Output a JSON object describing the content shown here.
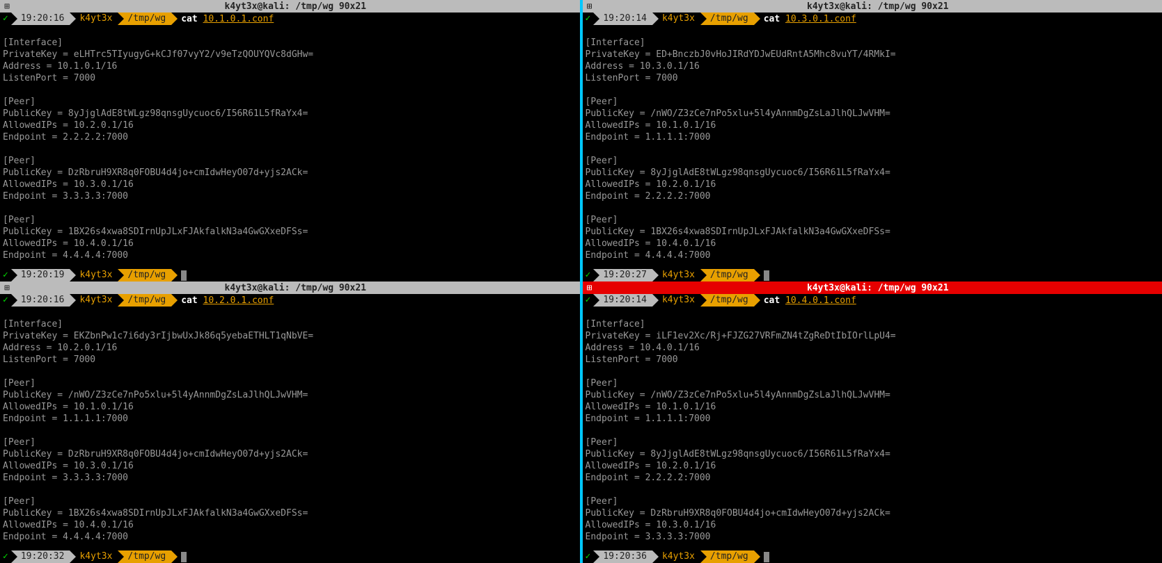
{
  "panes": [
    {
      "id": "p1",
      "active": false,
      "title": "k4yt3x@kali: /tmp/wg 90x21",
      "icon_glyph": "⊞",
      "prompt1": {
        "check": "✓",
        "time": "19:20:16",
        "user": "k4yt3x",
        "path": "/tmp/wg",
        "cmd_name": "cat",
        "cmd_arg": "10.1.0.1.conf"
      },
      "lines": [
        "[Interface]",
        "PrivateKey = eLHTrc5TIyugyG+kCJf07vyY2/v9eTzQOUYQVc8dGHw=",
        "Address = 10.1.0.1/16",
        "ListenPort = 7000",
        "",
        "[Peer]",
        "PublicKey = 8yJjglAdE8tWLgz98qnsgUycuoc6/I56R61L5fRaYx4=",
        "AllowedIPs = 10.2.0.1/16",
        "Endpoint = 2.2.2.2:7000",
        "",
        "[Peer]",
        "PublicKey = DzRbruH9XR8q0FOBU4d4jo+cmIdwHeyO07d+yjs2ACk=",
        "AllowedIPs = 10.3.0.1/16",
        "Endpoint = 3.3.3.3:7000",
        "",
        "[Peer]",
        "PublicKey = 1BX26s4xwa8SDIrnUpJLxFJAkfalkN3a4GwGXxeDFSs=",
        "AllowedIPs = 10.4.0.1/16",
        "Endpoint = 4.4.4.4:7000"
      ],
      "prompt2": {
        "check": "✓",
        "time": "19:20:19",
        "user": "k4yt3x",
        "path": "/tmp/wg"
      }
    },
    {
      "id": "p2",
      "active": false,
      "title": "k4yt3x@kali: /tmp/wg 90x21",
      "icon_glyph": "⊞",
      "prompt1": {
        "check": "✓",
        "time": "19:20:14",
        "user": "k4yt3x",
        "path": "/tmp/wg",
        "cmd_name": "cat",
        "cmd_arg": "10.3.0.1.conf"
      },
      "lines": [
        "[Interface]",
        "PrivateKey = ED+BnczbJ0vHoJIRdYDJwEUdRntA5Mhc8vuYT/4RMkI=",
        "Address = 10.3.0.1/16",
        "ListenPort = 7000",
        "",
        "[Peer]",
        "PublicKey = /nWO/Z3zCe7nPo5xlu+5l4yAnnmDgZsLaJlhQLJwVHM=",
        "AllowedIPs = 10.1.0.1/16",
        "Endpoint = 1.1.1.1:7000",
        "",
        "[Peer]",
        "PublicKey = 8yJjglAdE8tWLgz98qnsgUycuoc6/I56R61L5fRaYx4=",
        "AllowedIPs = 10.2.0.1/16",
        "Endpoint = 2.2.2.2:7000",
        "",
        "[Peer]",
        "PublicKey = 1BX26s4xwa8SDIrnUpJLxFJAkfalkN3a4GwGXxeDFSs=",
        "AllowedIPs = 10.4.0.1/16",
        "Endpoint = 4.4.4.4:7000"
      ],
      "prompt2": {
        "check": "✓",
        "time": "19:20:27",
        "user": "k4yt3x",
        "path": "/tmp/wg"
      }
    },
    {
      "id": "p3",
      "active": false,
      "title": "k4yt3x@kali: /tmp/wg 90x21",
      "icon_glyph": "⊞",
      "prompt1": {
        "check": "✓",
        "time": "19:20:16",
        "user": "k4yt3x",
        "path": "/tmp/wg",
        "cmd_name": "cat",
        "cmd_arg": "10.2.0.1.conf"
      },
      "lines": [
        "[Interface]",
        "PrivateKey = EKZbnPw1c7i6dy3rIjbwUxJk86q5yebaETHLT1qNbVE=",
        "Address = 10.2.0.1/16",
        "ListenPort = 7000",
        "",
        "[Peer]",
        "PublicKey = /nWO/Z3zCe7nPo5xlu+5l4yAnnmDgZsLaJlhQLJwVHM=",
        "AllowedIPs = 10.1.0.1/16",
        "Endpoint = 1.1.1.1:7000",
        "",
        "[Peer]",
        "PublicKey = DzRbruH9XR8q0FOBU4d4jo+cmIdwHeyO07d+yjs2ACk=",
        "AllowedIPs = 10.3.0.1/16",
        "Endpoint = 3.3.3.3:7000",
        "",
        "[Peer]",
        "PublicKey = 1BX26s4xwa8SDIrnUpJLxFJAkfalkN3a4GwGXxeDFSs=",
        "AllowedIPs = 10.4.0.1/16",
        "Endpoint = 4.4.4.4:7000"
      ],
      "prompt2": {
        "check": "✓",
        "time": "19:20:32",
        "user": "k4yt3x",
        "path": "/tmp/wg"
      }
    },
    {
      "id": "p4",
      "active": true,
      "title": "k4yt3x@kali: /tmp/wg 90x21",
      "icon_glyph": "⊞",
      "prompt1": {
        "check": "✓",
        "time": "19:20:14",
        "user": "k4yt3x",
        "path": "/tmp/wg",
        "cmd_name": "cat",
        "cmd_arg": "10.4.0.1.conf"
      },
      "lines": [
        "[Interface]",
        "PrivateKey = iLF1ev2Xc/Rj+FJZG27VRFmZN4tZgReDtIbIOrlLpU4=",
        "Address = 10.4.0.1/16",
        "ListenPort = 7000",
        "",
        "[Peer]",
        "PublicKey = /nWO/Z3zCe7nPo5xlu+5l4yAnnmDgZsLaJlhQLJwVHM=",
        "AllowedIPs = 10.1.0.1/16",
        "Endpoint = 1.1.1.1:7000",
        "",
        "[Peer]",
        "PublicKey = 8yJjglAdE8tWLgz98qnsgUycuoc6/I56R61L5fRaYx4=",
        "AllowedIPs = 10.2.0.1/16",
        "Endpoint = 2.2.2.2:7000",
        "",
        "[Peer]",
        "PublicKey = DzRbruH9XR8q0FOBU4d4jo+cmIdwHeyO07d+yjs2ACk=",
        "AllowedIPs = 10.3.0.1/16",
        "Endpoint = 3.3.3.3:7000"
      ],
      "prompt2": {
        "check": "✓",
        "time": "19:20:36",
        "user": "k4yt3x",
        "path": "/tmp/wg"
      }
    }
  ]
}
